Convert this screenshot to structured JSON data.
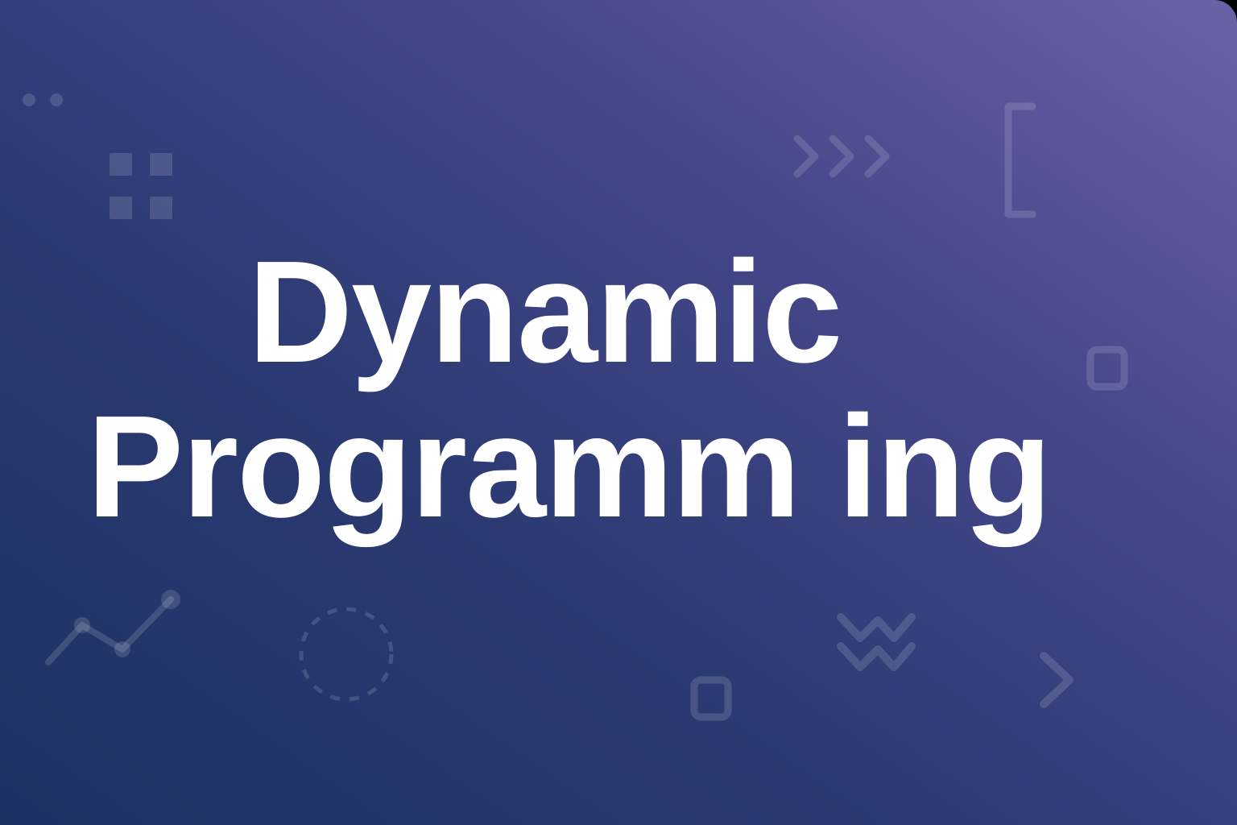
{
  "title": {
    "line1": "Dynamic",
    "line2": "Programm ing"
  },
  "colors": {
    "gradient_start": "#1c3263",
    "gradient_end": "#6a62a6",
    "title_text": "#ffffff",
    "decoration": "#ffffff"
  },
  "decorations": [
    "two-dots-icon",
    "four-squares-grid-icon",
    "triple-chevron-right-icon",
    "bracket-icon",
    "rounded-square-icon",
    "line-chart-icon",
    "dashed-circle-icon",
    "zigzag-icon",
    "chevron-right-icon"
  ]
}
